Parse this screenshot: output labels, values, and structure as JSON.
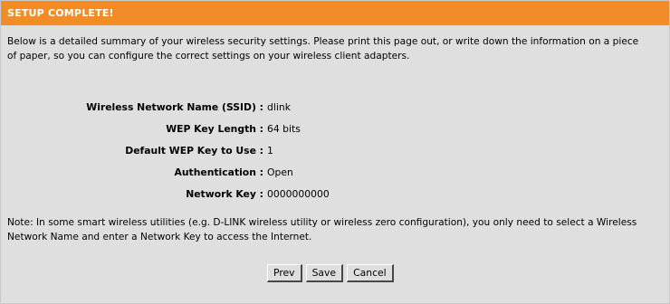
{
  "header": {
    "title": "SETUP COMPLETE!"
  },
  "intro": {
    "text": "Below is a detailed summary of your wireless security settings. Please print this page out, or write down the information on a piece of paper, so you can configure the correct settings on your wireless client adapters."
  },
  "summary": {
    "rows": [
      {
        "label": "Wireless Network Name (SSID) :",
        "value": "dlink"
      },
      {
        "label": "WEP Key Length :",
        "value": "64 bits"
      },
      {
        "label": "Default WEP Key to Use :",
        "value": "1"
      },
      {
        "label": "Authentication :",
        "value": "Open"
      },
      {
        "label": "Network Key :",
        "value": "0000000000"
      }
    ]
  },
  "note": {
    "text": "Note: In some smart wireless utilities (e.g. D-LINK wireless utility or wireless zero configuration), you only need to select a Wireless Network Name and enter a Network Key to access the Internet."
  },
  "buttons": {
    "prev_label": "Prev",
    "save_label": "Save",
    "cancel_label": "Cancel"
  },
  "colors": {
    "header_background": "#f28c28",
    "panel_background": "#dfdfdf"
  }
}
